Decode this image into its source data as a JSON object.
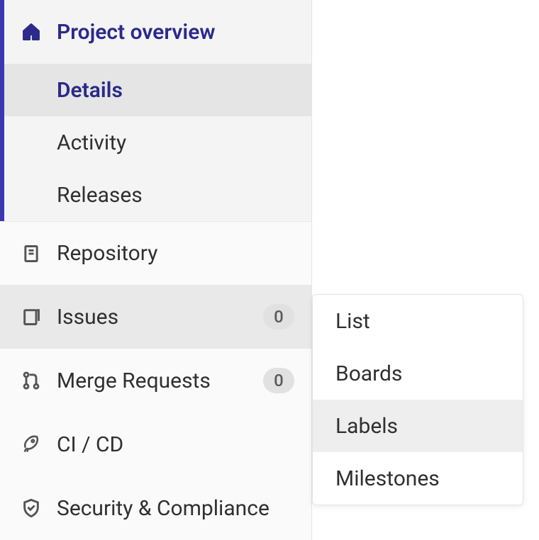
{
  "sidebar": {
    "overview": {
      "label": "Project overview",
      "sub": {
        "details": "Details",
        "activity": "Activity",
        "releases": "Releases"
      }
    },
    "repository": {
      "label": "Repository"
    },
    "issues": {
      "label": "Issues",
      "badge": "0"
    },
    "merge_requests": {
      "label": "Merge Requests",
      "badge": "0"
    },
    "cicd": {
      "label": "CI / CD"
    },
    "security": {
      "label": "Security & Compliance"
    }
  },
  "flyout": {
    "list": "List",
    "boards": "Boards",
    "labels": "Labels",
    "milestones": "Milestones"
  }
}
